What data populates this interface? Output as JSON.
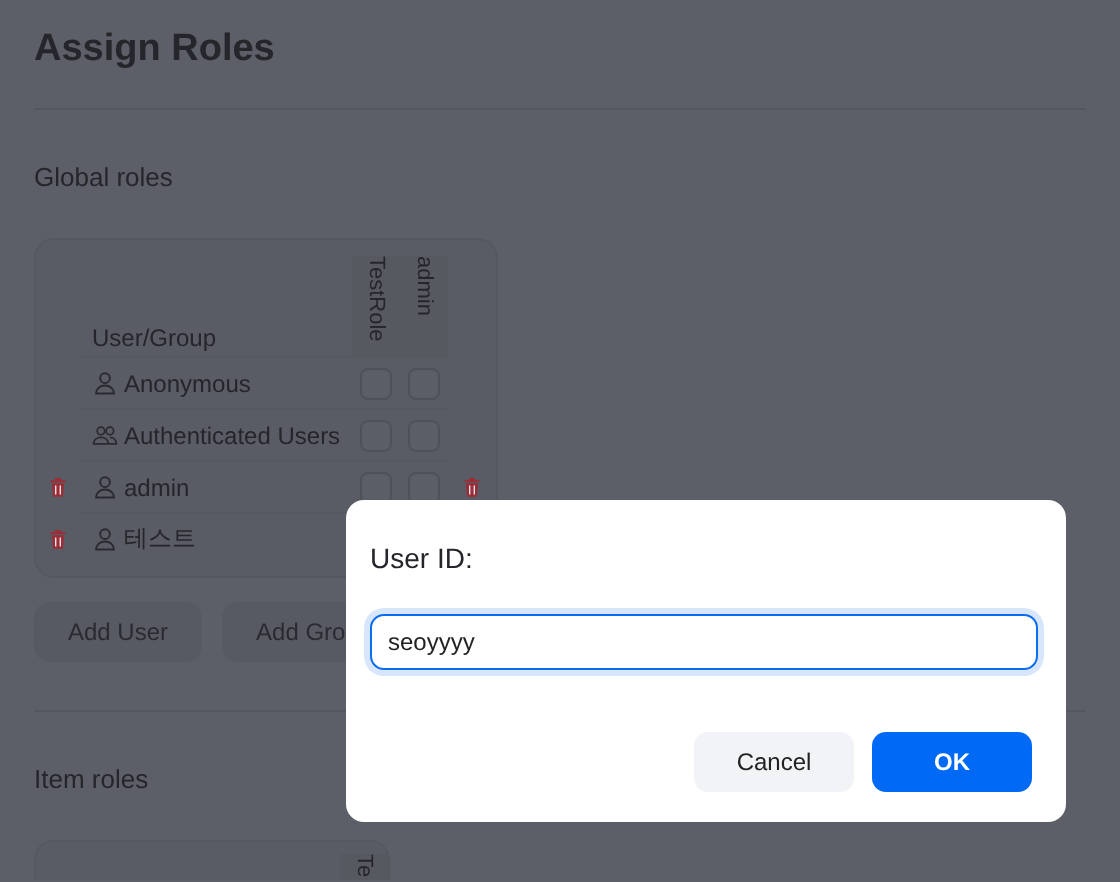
{
  "page": {
    "title": "Assign Roles"
  },
  "global_roles": {
    "heading": "Global roles",
    "name_column": "User/Group",
    "roles": [
      {
        "name": "TestRole",
        "deletable": false
      },
      {
        "name": "admin",
        "deletable": true
      }
    ],
    "rows": [
      {
        "name": "Anonymous",
        "kind": "user",
        "deletable": false,
        "checks": [
          {
            "checked": false
          },
          {
            "checked": false
          }
        ]
      },
      {
        "name": "Authenticated Users",
        "kind": "group",
        "deletable": false,
        "checks": [
          {
            "checked": false
          },
          {
            "checked": false
          }
        ]
      },
      {
        "name": "admin",
        "kind": "user",
        "deletable": true,
        "checks": [
          {
            "checked": false
          },
          {
            "checked": false
          }
        ]
      },
      {
        "name": "테스트",
        "kind": "user",
        "deletable": true,
        "checks": []
      }
    ],
    "buttons": [
      "Add User",
      "Add Gro"
    ]
  },
  "item_roles": {
    "heading": "Item roles",
    "roles": [
      {
        "name": "Te"
      }
    ]
  },
  "dialog": {
    "label": "User ID:",
    "value": "seoyyyy",
    "buttons": [
      {
        "label": "Cancel",
        "kind": "secondary"
      },
      {
        "label": "OK",
        "kind": "primary"
      }
    ]
  }
}
